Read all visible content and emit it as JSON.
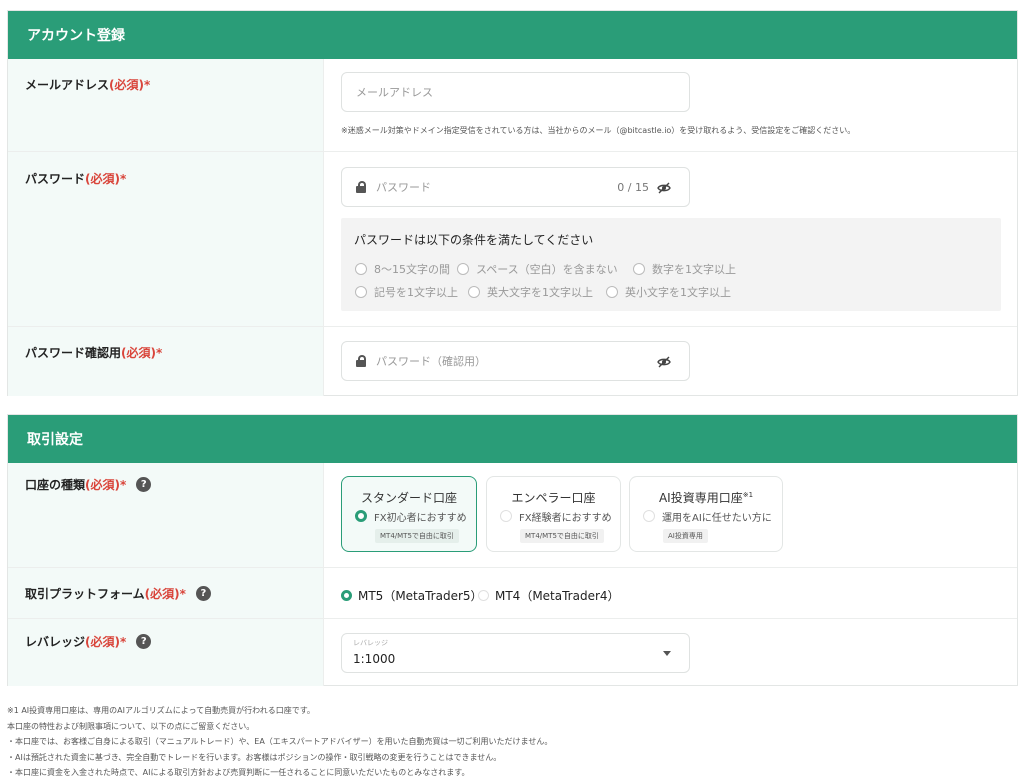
{
  "account": {
    "title": "アカウント登録",
    "email": {
      "label": "メールアドレス",
      "required": "(必須)*",
      "placeholder": "メールアドレス",
      "note": "※迷惑メール対策やドメイン指定受信をされている方は、当社からのメール（@bitcastle.io）を受け取れるよう、受信設定をご確認ください。"
    },
    "password": {
      "label": "パスワード",
      "required": "(必須)*",
      "placeholder": "パスワード",
      "counter": "0 / 15",
      "conditions_title": "パスワードは以下の条件を満たしてください",
      "conditions": [
        "8〜15文字の間",
        "スペース（空白）を含まない",
        "数字を1文字以上",
        "記号を1文字以上",
        "英大文字を1文字以上",
        "英小文字を1文字以上"
      ]
    },
    "password_confirm": {
      "label": "パスワード確認用",
      "required": "(必須)*",
      "placeholder": "パスワード（確認用）"
    }
  },
  "trading": {
    "title": "取引設定",
    "account_type": {
      "label": "口座の種類",
      "required": "(必須)*",
      "help": "?",
      "cards": [
        {
          "title": "スタンダード口座",
          "sub": "FX初心者におすすめ",
          "tag": "MT4/MT5で自由に取引",
          "selected": true
        },
        {
          "title": "エンペラー口座",
          "sub": "FX経験者におすすめ",
          "tag": "MT4/MT5で自由に取引",
          "selected": false
        },
        {
          "title": "AI投資専用口座",
          "title_sup": "※1",
          "sub": "運用をAIに任せたい方に",
          "tag": "AI投資専用",
          "selected": false
        }
      ]
    },
    "platform": {
      "label": "取引プラットフォーム",
      "required": "(必須)*",
      "help": "?",
      "options": [
        {
          "label": "MT5（MetaTrader5）",
          "selected": true
        },
        {
          "label": "MT4（MetaTrader4）",
          "selected": false
        }
      ]
    },
    "leverage": {
      "label": "レバレッジ",
      "required": "(必須)*",
      "help": "?",
      "select_caption": "レバレッジ",
      "value": "1:1000"
    }
  },
  "footnotes": [
    "※1 AI投資専用口座は、専用のAIアルゴリズムによって自動売買が行われる口座です。",
    "本口座の特性および制限事項について、以下の点にご留意ください。",
    "・本口座では、お客様ご自身による取引（マニュアルトレード）や、EA（エキスパートアドバイザー）を用いた自動売買は一切ご利用いただけません。",
    "・AIは預託された資金に基づき、完全自動でトレードを行います。お客様はポジションの操作・取引戦略の変更を行うことはできません。",
    "・本口座に資金を入金された時点で、AIによる取引方針および売買判断に一任されることに同意いただいたものとみなされます。"
  ],
  "colors": {
    "brand_green": "#2a9d78",
    "required_red": "#d9453b",
    "label_bg": "#f3faf8"
  }
}
